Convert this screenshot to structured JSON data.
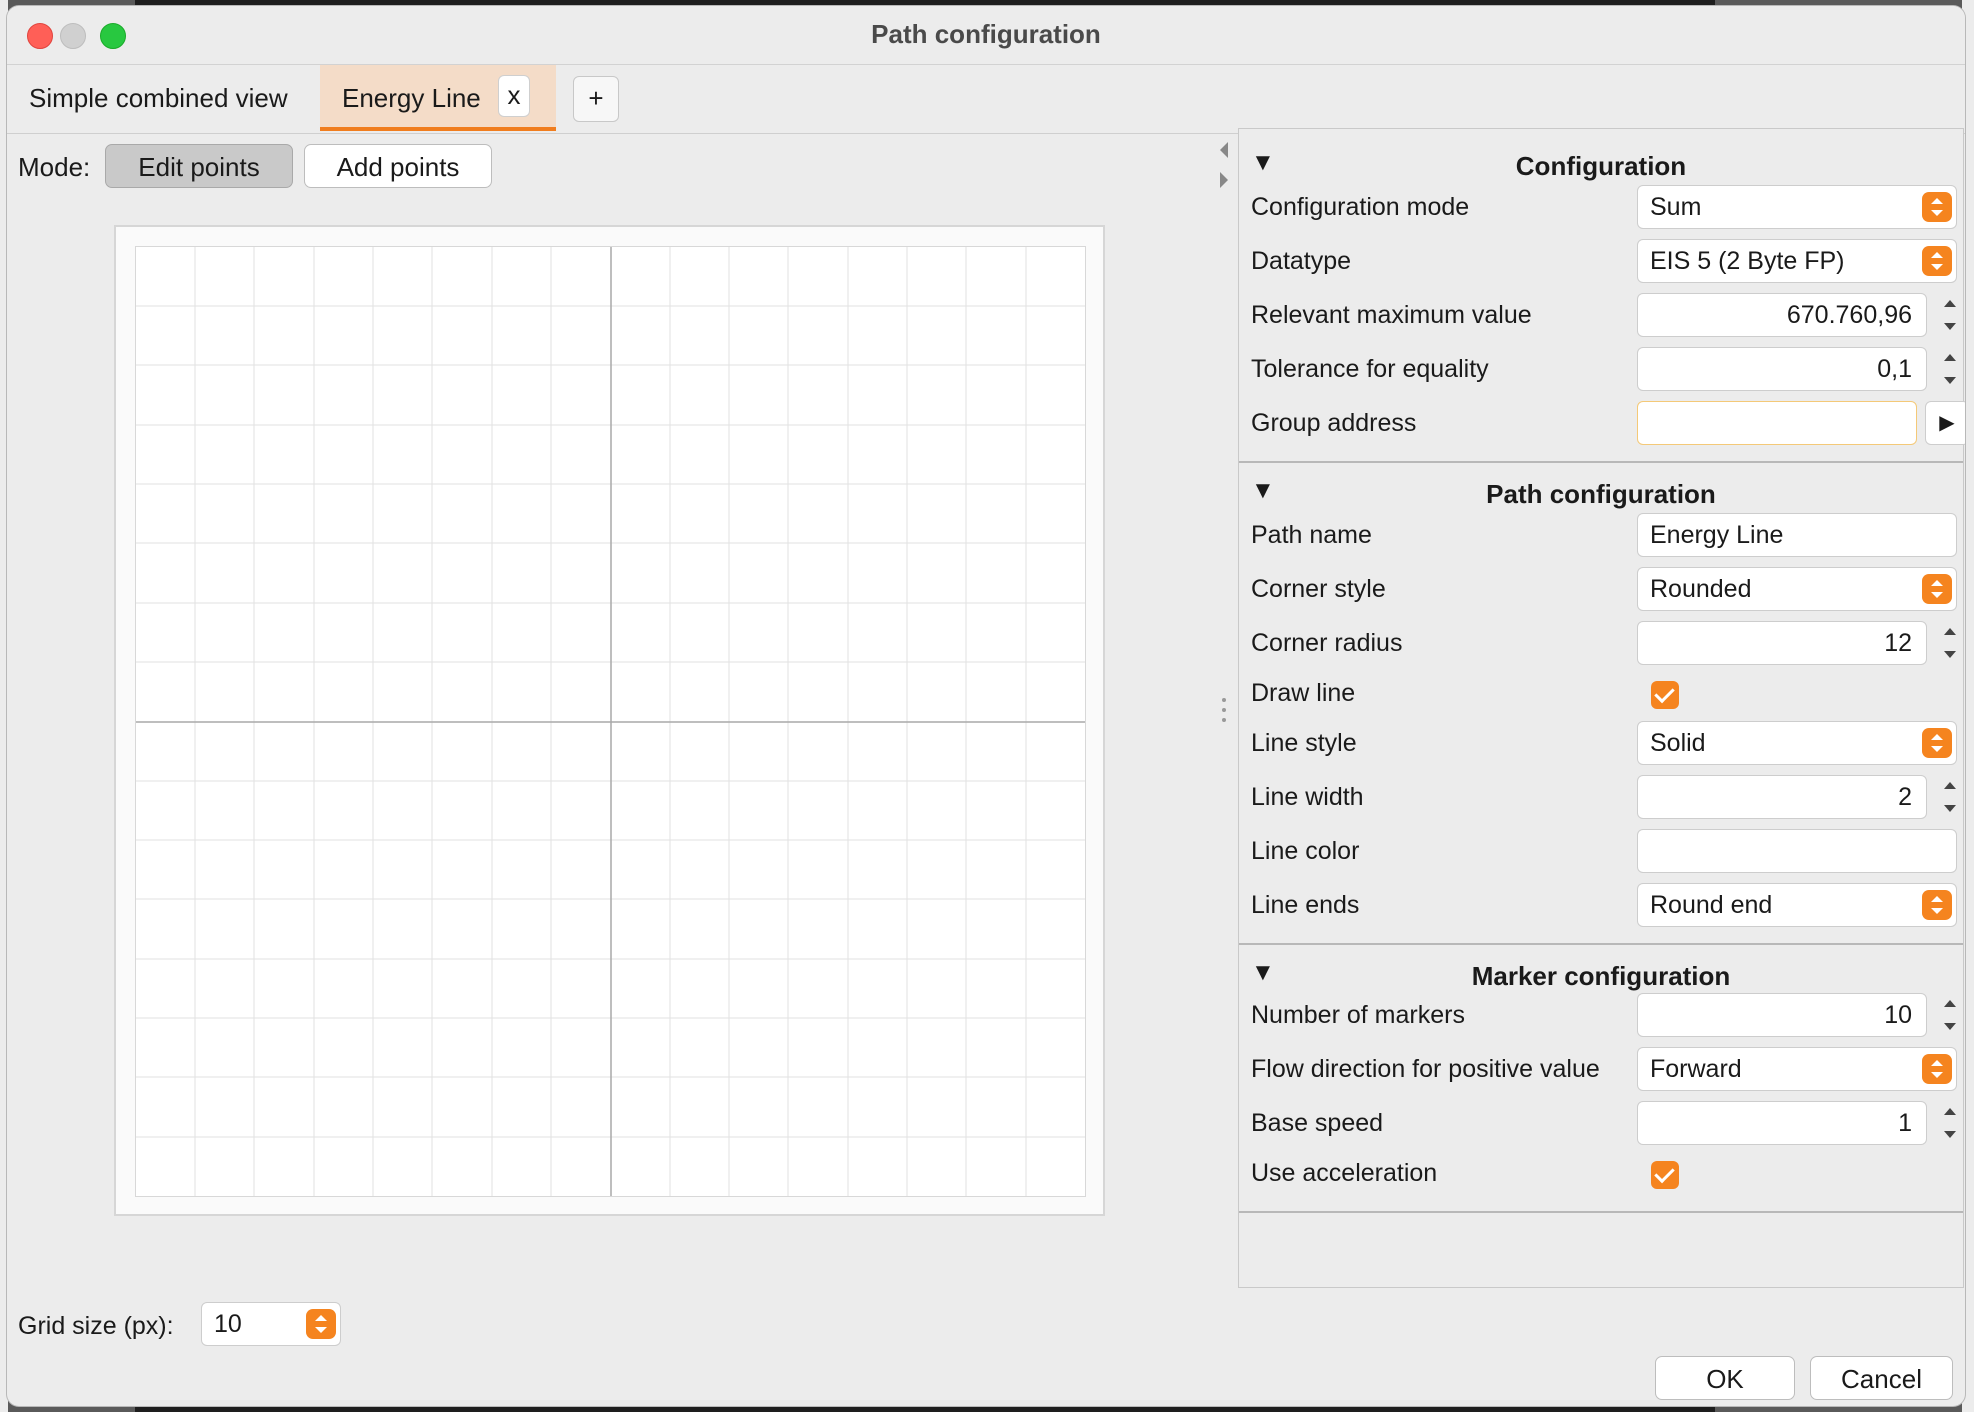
{
  "window": {
    "title": "Path configuration"
  },
  "tabs": [
    {
      "label": "Simple combined view",
      "active": false
    },
    {
      "label": "Energy Line",
      "active": true,
      "close_label": "x"
    }
  ],
  "tab_add_label": "+",
  "mode": {
    "label": "Mode:",
    "edit_points_label": "Edit points",
    "add_points_label": "Add points",
    "selected": "Edit points"
  },
  "grid": {
    "label": "Grid size (px):",
    "value": "10"
  },
  "sections": {
    "configuration": {
      "title": "Configuration",
      "arrow": "▼",
      "rows": {
        "configuration_mode": {
          "label": "Configuration mode",
          "value": "Sum"
        },
        "datatype": {
          "label": "Datatype",
          "value": "EIS 5 (2 Byte FP)"
        },
        "relevant_max": {
          "label": "Relevant maximum value",
          "value": "670.760,96"
        },
        "tolerance": {
          "label": "Tolerance for equality",
          "value": "0,1"
        },
        "group_address": {
          "label": "Group address",
          "value": "",
          "button": "▶"
        }
      }
    },
    "path": {
      "title": "Path configuration",
      "arrow": "▼",
      "rows": {
        "path_name": {
          "label": "Path name",
          "value": "Energy Line"
        },
        "corner_style": {
          "label": "Corner style",
          "value": "Rounded"
        },
        "corner_radius": {
          "label": "Corner radius",
          "value": "12"
        },
        "draw_line": {
          "label": "Draw line",
          "checked": true
        },
        "line_style": {
          "label": "Line style",
          "value": "Solid"
        },
        "line_width": {
          "label": "Line width",
          "value": "2"
        },
        "line_color": {
          "label": "Line color",
          "value": ""
        },
        "line_ends": {
          "label": "Line ends",
          "value": "Round end"
        }
      }
    },
    "marker": {
      "title": "Marker configuration",
      "arrow": "▼",
      "rows": {
        "number_of_markers": {
          "label": "Number of markers",
          "value": "10"
        },
        "flow_direction": {
          "label": "Flow direction for positive value",
          "value": "Forward"
        },
        "base_speed": {
          "label": "Base speed",
          "value": "1"
        },
        "use_acceleration": {
          "label": "Use acceleration",
          "checked": true
        }
      }
    }
  },
  "footer": {
    "ok_label": "OK",
    "cancel_label": "Cancel"
  },
  "colors": {
    "accent": "#f5841f",
    "tab_active_bg": "#f4dcc8",
    "window_bg": "#ececec"
  }
}
